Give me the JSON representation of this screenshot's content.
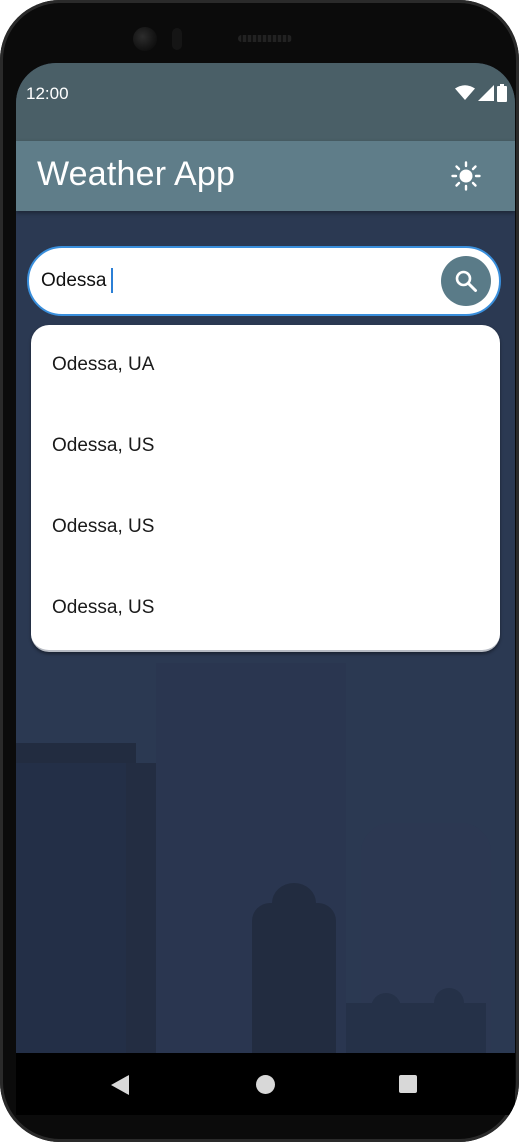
{
  "status_bar": {
    "time": "12:00",
    "icons": [
      "wifi-icon",
      "signal-icon",
      "battery-icon"
    ]
  },
  "app_bar": {
    "title": "Weather App",
    "theme_toggle_icon": "sun-icon"
  },
  "search": {
    "value": "Odessa",
    "button_icon": "search-icon"
  },
  "suggestions": [
    {
      "label": "Odessa, UA"
    },
    {
      "label": "Odessa, US"
    },
    {
      "label": "Odessa, US"
    },
    {
      "label": "Odessa, US"
    }
  ],
  "nav": {
    "back_icon": "back-triangle-icon",
    "home_icon": "home-circle-icon",
    "recent_icon": "recent-square-icon"
  },
  "colors": {
    "status_bar": "#4a5f67",
    "app_bar": "#5f7d89",
    "background": "#2b3952",
    "search_border": "#3a8fdc",
    "search_button": "#5a7b88"
  }
}
